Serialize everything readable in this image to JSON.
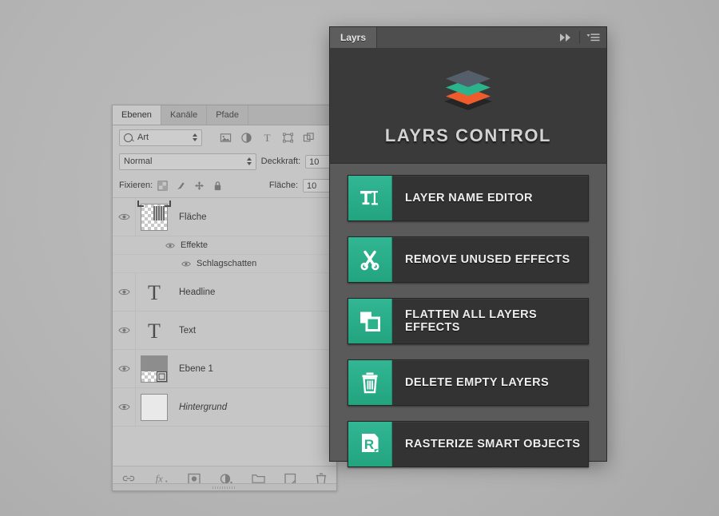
{
  "photoshop_panel": {
    "tabs": [
      {
        "label": "Ebenen",
        "active": true
      },
      {
        "label": "Kanäle",
        "active": false
      },
      {
        "label": "Pfade",
        "active": false
      }
    ],
    "filter": {
      "type_label": "Art",
      "icons": [
        "image-filter-icon",
        "adjustment-filter-icon",
        "type-filter-icon",
        "shape-filter-icon",
        "smart-object-filter-icon"
      ]
    },
    "blend_mode": "Normal",
    "opacity_label": "Deckkraft:",
    "opacity_value": "10",
    "lock_label": "Fixieren:",
    "fill_label": "Fläche:",
    "fill_value": "10",
    "lock_icons": [
      "lock-transparency-icon",
      "lock-image-icon",
      "lock-position-icon",
      "lock-all-icon"
    ],
    "layers": [
      {
        "name": "Fläche",
        "kind": "pixel",
        "visible": true,
        "selected": true,
        "children": [
          {
            "name": "Effekte",
            "level": 1,
            "visible": true
          },
          {
            "name": "Schlagschatten",
            "level": 2,
            "visible": true
          }
        ]
      },
      {
        "name": "Headline",
        "kind": "type",
        "visible": true,
        "children": []
      },
      {
        "name": "Text",
        "kind": "type",
        "visible": true,
        "children": []
      },
      {
        "name": "Ebene 1",
        "kind": "smart",
        "visible": true,
        "children": []
      },
      {
        "name": "Hintergrund",
        "kind": "background",
        "visible": true,
        "italic": true,
        "children": []
      }
    ],
    "footer_icons": [
      "link-icon",
      "fx-icon",
      "layer-mask-icon",
      "adjustment-layer-icon",
      "new-group-icon",
      "new-layer-icon",
      "delete-layer-icon"
    ]
  },
  "layrs_panel": {
    "tab_label": "Layrs",
    "collapse_icon": "double-chevron-right-icon",
    "menu_icon": "panel-menu-icon",
    "logo_icon": "layers-stack-logo",
    "logo_colors": [
      "#555f6b",
      "#2bb48c",
      "#ef5c2b"
    ],
    "title": "LAYRS CONTROL",
    "accent_color": "#27b08a",
    "buttons": [
      {
        "label": "LAYER NAME EDITOR",
        "icon": "text-cursor-icon"
      },
      {
        "label": "REMOVE UNUSED EFFECTS",
        "icon": "scissors-icon"
      },
      {
        "label": "FLATTEN ALL LAYERS EFFECTS",
        "icon": "flatten-squares-icon"
      },
      {
        "label": "DELETE EMPTY LAYERS",
        "icon": "trash-icon"
      },
      {
        "label": "RASTERIZE SMART OBJECTS",
        "icon": "rasterize-page-icon"
      }
    ]
  }
}
